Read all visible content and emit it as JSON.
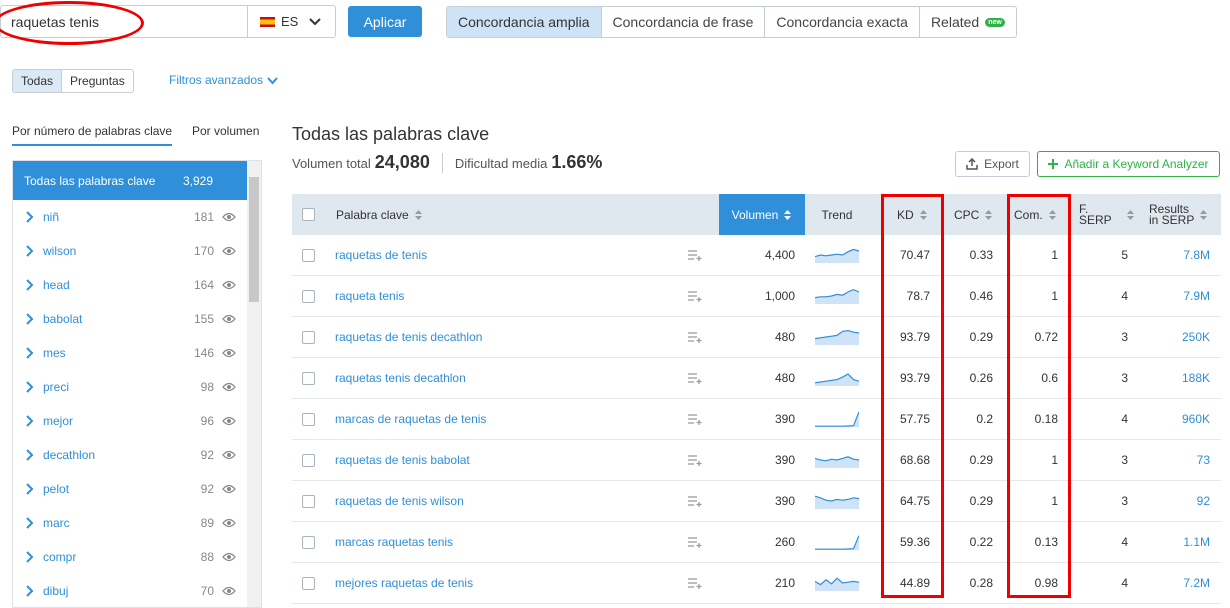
{
  "search": {
    "value": "raquetas tenis",
    "db": "ES",
    "apply": "Aplicar"
  },
  "match_tabs": [
    {
      "label": "Concordancia amplia",
      "active": true
    },
    {
      "label": "Concordancia de frase",
      "active": false
    },
    {
      "label": "Concordancia exacta",
      "active": false
    },
    {
      "label": "Related",
      "active": false,
      "badge": "new"
    }
  ],
  "type_tabs": [
    {
      "label": "Todas",
      "active": true
    },
    {
      "label": "Preguntas",
      "active": false
    }
  ],
  "advanced_filters": "Filtros avanzados",
  "sidebar": {
    "tab_words": "Por número de palabras clave",
    "tab_volume": "Por volumen",
    "all_label": "Todas las palabras clave",
    "all_count": "3,929",
    "groups": [
      {
        "label": "niñ",
        "count": "181"
      },
      {
        "label": "wilson",
        "count": "170"
      },
      {
        "label": "head",
        "count": "164"
      },
      {
        "label": "babolat",
        "count": "155"
      },
      {
        "label": "mes",
        "count": "146"
      },
      {
        "label": "preci",
        "count": "98"
      },
      {
        "label": "mejor",
        "count": "96"
      },
      {
        "label": "decathlon",
        "count": "92"
      },
      {
        "label": "pelot",
        "count": "92"
      },
      {
        "label": "marc",
        "count": "89"
      },
      {
        "label": "compr",
        "count": "88"
      },
      {
        "label": "dibuj",
        "count": "70"
      }
    ]
  },
  "main": {
    "title": "Todas las palabras clave",
    "volume_label": "Volumen total",
    "volume_value": "24,080",
    "difficulty_label": "Dificultad media",
    "difficulty_value": "1.66%",
    "export_label": "Export",
    "add_label": "Añadir a Keyword Analyzer"
  },
  "table": {
    "columns": {
      "keyword": "Palabra clave",
      "volume": "Volumen",
      "trend": "Trend",
      "kd": "KD",
      "cpc": "CPC",
      "com": "Com.",
      "serp_1": "F.",
      "serp_2": "SERP",
      "results_1": "Results",
      "results_2": "in SERP"
    },
    "rows": [
      {
        "keyword": "raquetas de tenis",
        "volume": "4,400",
        "kd": "70.47",
        "cpc": "0.33",
        "com": "1",
        "serp": "5",
        "results": "7.8M",
        "trend": [
          0.4,
          0.5,
          0.45,
          0.5,
          0.55,
          0.5,
          0.7,
          0.85,
          0.75
        ]
      },
      {
        "keyword": "raqueta tenis",
        "volume": "1,000",
        "kd": "78.7",
        "cpc": "0.46",
        "com": "1",
        "serp": "4",
        "results": "7.9M",
        "trend": [
          0.4,
          0.45,
          0.45,
          0.5,
          0.6,
          0.55,
          0.75,
          0.9,
          0.75
        ]
      },
      {
        "keyword": "raquetas de tenis decathlon",
        "volume": "480",
        "kd": "93.79",
        "cpc": "0.29",
        "com": "0.72",
        "serp": "3",
        "results": "250K",
        "trend": [
          0.4,
          0.45,
          0.5,
          0.55,
          0.6,
          0.85,
          0.9,
          0.8,
          0.75
        ]
      },
      {
        "keyword": "raquetas tenis decathlon",
        "volume": "480",
        "kd": "93.79",
        "cpc": "0.26",
        "com": "0.6",
        "serp": "3",
        "results": "188K",
        "trend": [
          0.2,
          0.25,
          0.3,
          0.35,
          0.4,
          0.55,
          0.75,
          0.4,
          0.3
        ]
      },
      {
        "keyword": "marcas de raquetas de tenis",
        "volume": "390",
        "kd": "57.75",
        "cpc": "0.2",
        "com": "0.18",
        "serp": "4",
        "results": "960K",
        "trend": [
          0.05,
          0.05,
          0.05,
          0.05,
          0.05,
          0.05,
          0.06,
          0.08,
          0.95
        ]
      },
      {
        "keyword": "raquetas de tenis babolat",
        "volume": "390",
        "kd": "68.68",
        "cpc": "0.29",
        "com": "1",
        "serp": "3",
        "results": "73",
        "trend": [
          0.6,
          0.5,
          0.45,
          0.55,
          0.5,
          0.6,
          0.7,
          0.55,
          0.5
        ]
      },
      {
        "keyword": "raquetas de tenis wilson",
        "volume": "390",
        "kd": "64.75",
        "cpc": "0.29",
        "com": "1",
        "serp": "3",
        "results": "92",
        "trend": [
          0.8,
          0.7,
          0.55,
          0.5,
          0.6,
          0.55,
          0.6,
          0.7,
          0.65
        ]
      },
      {
        "keyword": "marcas raquetas tenis",
        "volume": "260",
        "kd": "59.36",
        "cpc": "0.22",
        "com": "0.13",
        "serp": "4",
        "results": "1.1M",
        "trend": [
          0.05,
          0.05,
          0.05,
          0.05,
          0.05,
          0.05,
          0.06,
          0.08,
          0.9
        ]
      },
      {
        "keyword": "mejores raquetas de tenis",
        "volume": "210",
        "kd": "44.89",
        "cpc": "0.28",
        "com": "0.98",
        "serp": "4",
        "results": "7.2M",
        "trend": [
          0.6,
          0.4,
          0.7,
          0.45,
          0.8,
          0.5,
          0.55,
          0.6,
          0.55
        ]
      }
    ]
  },
  "colors": {
    "accent": "#2f8fd9",
    "green": "#2fb248",
    "highlight": "#e00000"
  }
}
